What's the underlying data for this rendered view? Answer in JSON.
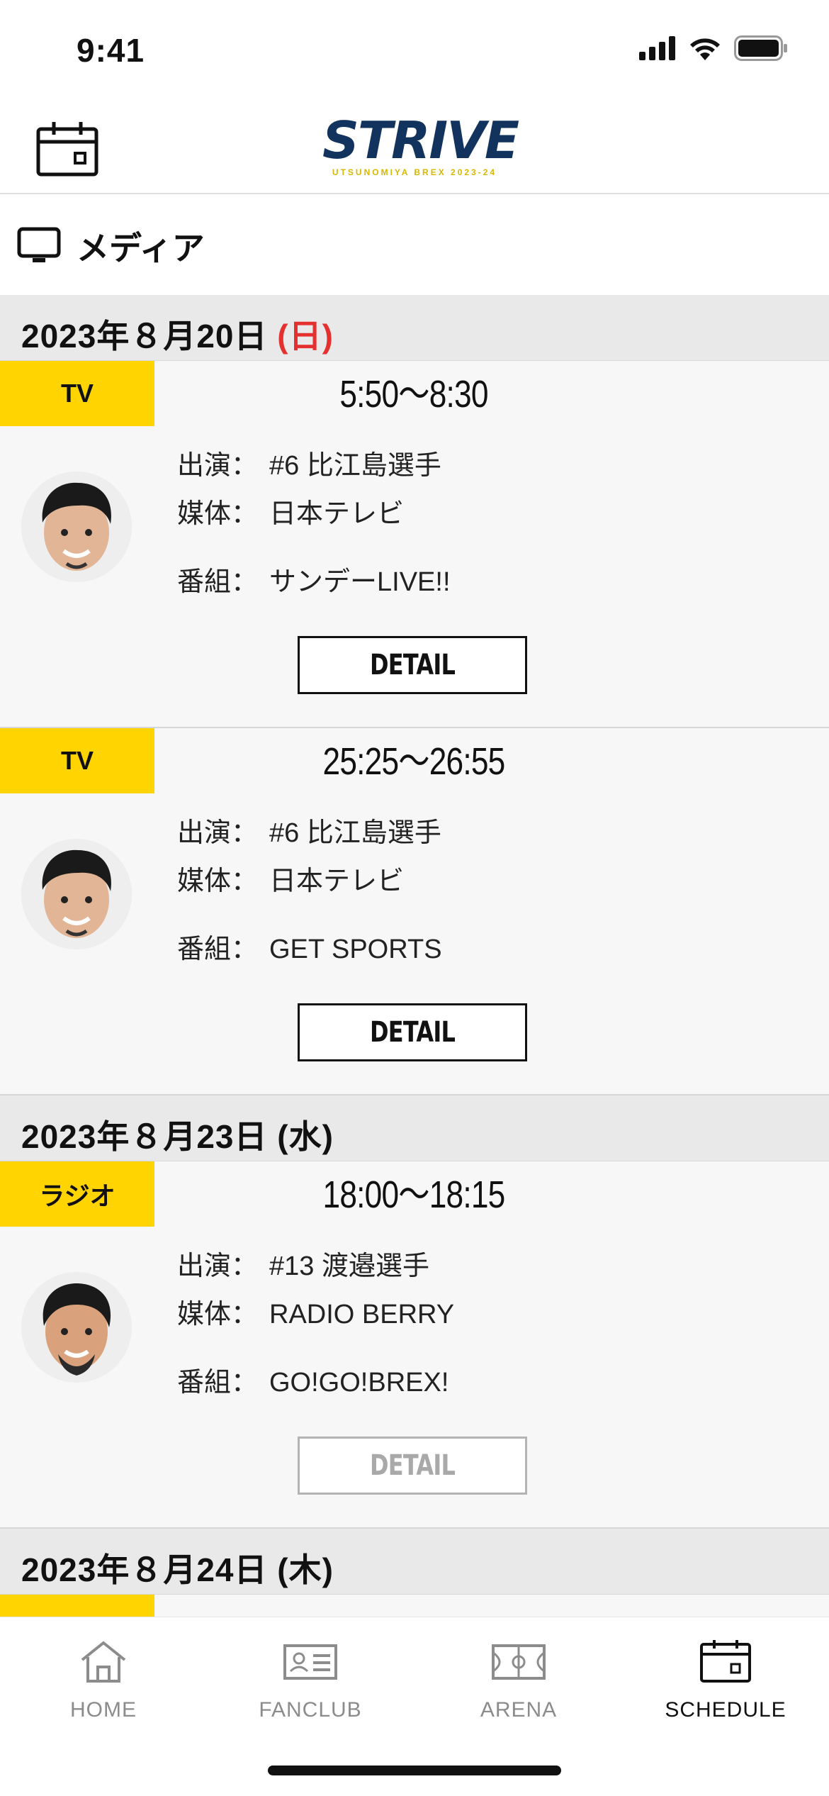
{
  "status_bar": {
    "time": "9:41"
  },
  "header": {
    "logo_text": "STRIVE",
    "logo_sub": "UTSUNOMIYA BREX 2023-24",
    "calendar_icon": "calendar-icon"
  },
  "section": {
    "icon": "tv-icon",
    "title": "メディア"
  },
  "days": [
    {
      "date": "2023年８月20日",
      "dow": "(日)",
      "items": [
        {
          "type": "TV",
          "time": "5:50〜8:30",
          "performer_label": "出演：",
          "performer": "#6 比江島選手",
          "media_label": "媒体：",
          "media": "日本テレビ",
          "program_label": "番組：",
          "program": "サンデーLIVE!!",
          "detail": "DETAIL"
        },
        {
          "type": "TV",
          "time": "25:25〜26:55",
          "performer_label": "出演：",
          "performer": "#6 比江島選手",
          "media_label": "媒体：",
          "media": "日本テレビ",
          "program_label": "番組：",
          "program": "GET SPORTS",
          "detail": "DETAIL"
        }
      ]
    },
    {
      "date": "2023年８月23日",
      "dow": "(水)",
      "items": [
        {
          "type": "ラジオ",
          "time": "18:00〜18:15",
          "performer_label": "出演：",
          "performer": "#13 渡邉選手",
          "media_label": "媒体：",
          "media": "RADIO BERRY",
          "program_label": "番組：",
          "program": "GO!GO!BREX!",
          "detail": "DETAIL"
        }
      ]
    },
    {
      "date": "2023年８月24日",
      "dow": "(木)",
      "items": []
    }
  ],
  "tab_bar": {
    "tabs": [
      {
        "label": "HOME",
        "icon": "home-icon"
      },
      {
        "label": "FANCLUB",
        "icon": "id-card-icon"
      },
      {
        "label": "ARENA",
        "icon": "court-icon"
      },
      {
        "label": "SCHEDULE",
        "icon": "calendar-icon",
        "active": true
      }
    ]
  },
  "colors": {
    "badge": "#ffd400",
    "sunday": "#e53030",
    "date_bg": "#e9e9e9",
    "logo_navy": "#12335e"
  }
}
